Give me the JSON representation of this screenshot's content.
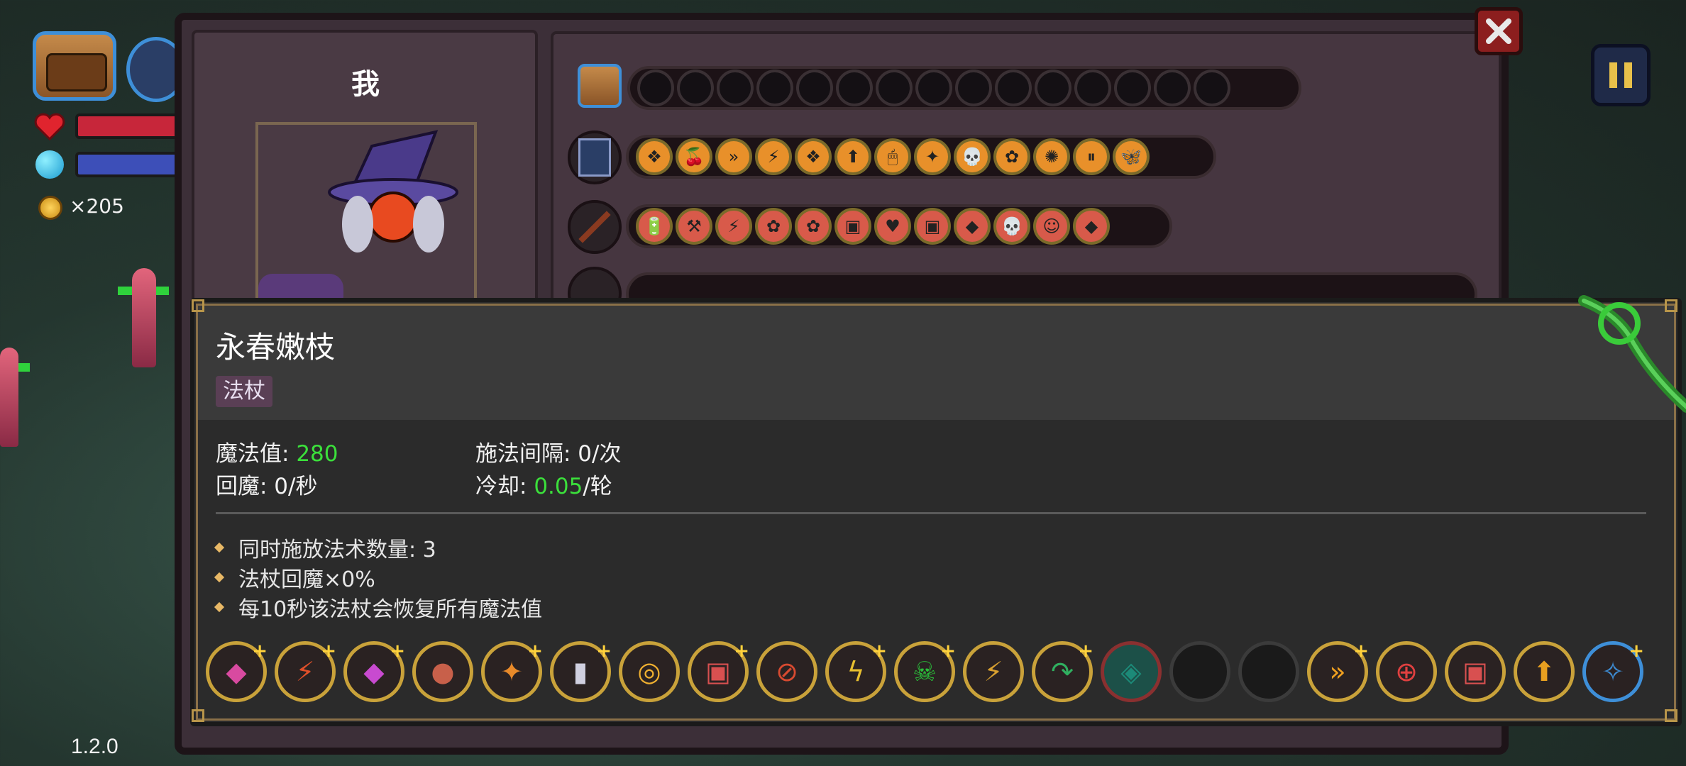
{
  "hud": {
    "gold_count": "×205",
    "version": "1.2.0"
  },
  "character": {
    "name": "我"
  },
  "wand_rows": {
    "row1_empty_slots": 15,
    "row2_slots": [
      "❖",
      "🍒",
      "»",
      "⚡",
      "❖",
      "⬆",
      "🖱",
      "✦",
      "💀",
      "✿",
      "✺",
      "⏸",
      "🦋"
    ],
    "row3_slots": [
      "🔋",
      "⚒",
      "⚡",
      "✿",
      "✿",
      "▣",
      "♥",
      "▣",
      "◆",
      "💀",
      "☺",
      "◆"
    ]
  },
  "tooltip": {
    "title": "永春嫩枝",
    "tag": "法杖",
    "mana_label": "魔法值: ",
    "mana_value": "280",
    "regen": "回魔: 0/秒",
    "cast_interval": "施法间隔: 0/次",
    "cooldown_label": "冷却: ",
    "cooldown_value": "0.05",
    "cooldown_unit": "/轮",
    "bullets": [
      "同时施放法术数量: 3",
      "法杖回魔×0%",
      "每10秒该法杖会恢复所有魔法值"
    ],
    "spells": [
      {
        "glyph": "◆",
        "plus": true,
        "empty": false,
        "icon": "crystal-icon"
      },
      {
        "glyph": "⚡",
        "plus": true,
        "empty": false,
        "icon": "fire-claw-icon"
      },
      {
        "glyph": "◆",
        "plus": true,
        "empty": false,
        "icon": "crystal-icon"
      },
      {
        "glyph": "●",
        "plus": false,
        "empty": false,
        "icon": "meat-icon"
      },
      {
        "glyph": "✦",
        "plus": true,
        "empty": false,
        "icon": "split-icon"
      },
      {
        "glyph": "▮",
        "plus": true,
        "empty": false,
        "icon": "battery-icon"
      },
      {
        "glyph": "◎",
        "plus": false,
        "empty": false,
        "icon": "burst-icon"
      },
      {
        "glyph": "▣",
        "plus": true,
        "empty": false,
        "icon": "box-icon"
      },
      {
        "glyph": "⊘",
        "plus": false,
        "empty": false,
        "icon": "orbit-icon"
      },
      {
        "glyph": "ϟ",
        "plus": true,
        "empty": false,
        "icon": "lightning-icon"
      },
      {
        "glyph": "☠",
        "plus": true,
        "empty": false,
        "icon": "skull-icon"
      },
      {
        "glyph": "⚡",
        "plus": false,
        "empty": false,
        "icon": "bolt-icon"
      },
      {
        "glyph": "↷",
        "plus": true,
        "empty": false,
        "icon": "arc-icon"
      },
      {
        "glyph": "◈",
        "plus": false,
        "empty": false,
        "icon": "rune-icon"
      },
      {
        "glyph": "",
        "plus": false,
        "empty": true,
        "icon": "empty-slot"
      },
      {
        "glyph": "",
        "plus": false,
        "empty": true,
        "icon": "empty-slot"
      },
      {
        "glyph": "»",
        "plus": true,
        "empty": false,
        "icon": "speed-icon"
      },
      {
        "glyph": "⊕",
        "plus": false,
        "empty": false,
        "icon": "target-icon"
      },
      {
        "glyph": "▣",
        "plus": false,
        "empty": false,
        "icon": "box-icon"
      },
      {
        "glyph": "⬆",
        "plus": false,
        "empty": false,
        "icon": "up-arrow-icon"
      },
      {
        "glyph": "✧",
        "plus": true,
        "empty": false,
        "icon": "pickaxe-icon"
      }
    ]
  },
  "colors": {
    "highlight_green": "#3be03b",
    "gold_border": "#c9a23a",
    "panel_bg": "#3c2f38"
  }
}
